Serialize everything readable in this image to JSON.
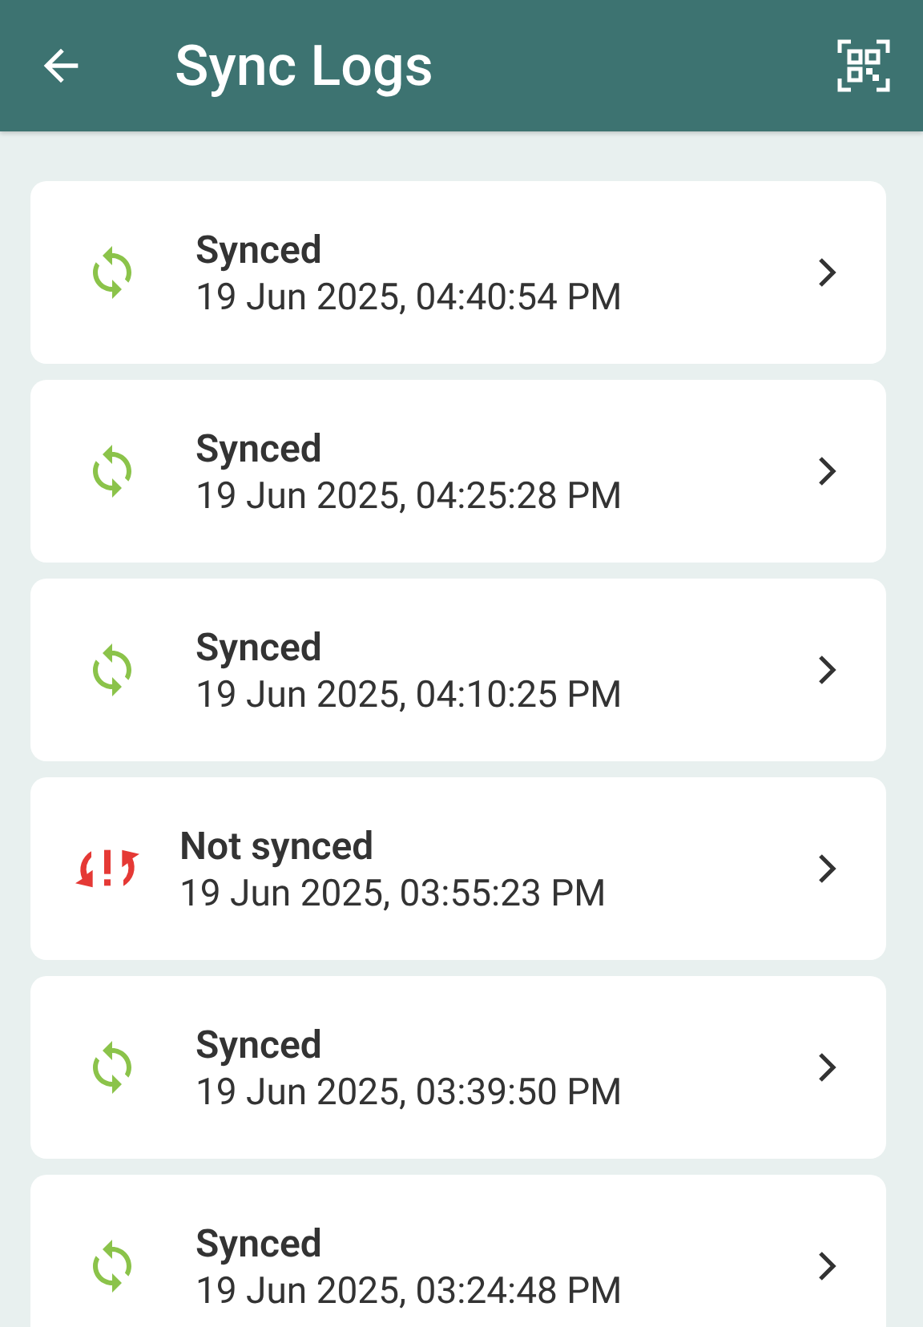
{
  "app_bar": {
    "title": "Sync Logs"
  },
  "logs": [
    {
      "kind": "synced",
      "status": "Synced",
      "time": "19 Jun 2025, 04:40:54 PM"
    },
    {
      "kind": "synced",
      "status": "Synced",
      "time": "19 Jun 2025, 04:25:28 PM"
    },
    {
      "kind": "synced",
      "status": "Synced",
      "time": "19 Jun 2025, 04:10:25 PM"
    },
    {
      "kind": "failed",
      "status": "Not synced",
      "time": "19 Jun 2025, 03:55:23 PM"
    },
    {
      "kind": "synced",
      "status": "Synced",
      "time": "19 Jun 2025, 03:39:50 PM"
    },
    {
      "kind": "synced",
      "status": "Synced",
      "time": "19 Jun 2025, 03:24:48 PM"
    }
  ]
}
